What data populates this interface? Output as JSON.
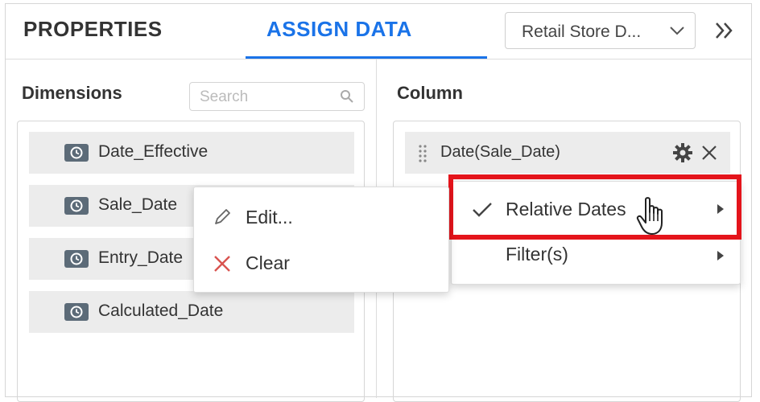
{
  "tabs": {
    "properties": "PROPERTIES",
    "assign_data": "ASSIGN DATA"
  },
  "datasource": {
    "selected": "Retail Store D..."
  },
  "dimensions": {
    "title": "Dimensions",
    "search_placeholder": "Search",
    "items": [
      {
        "label": "Date_Effective"
      },
      {
        "label": "Sale_Date"
      },
      {
        "label": "Entry_Date"
      },
      {
        "label": "Calculated_Date"
      }
    ]
  },
  "column": {
    "title": "Column",
    "item_label": "Date(Sale_Date)"
  },
  "column_menu": {
    "items": [
      {
        "label": "Relative Dates",
        "checked": true,
        "has_submenu": true
      },
      {
        "label": "Filter(s)",
        "checked": false,
        "has_submenu": true
      }
    ]
  },
  "context_menu": {
    "items": [
      {
        "label": "Edit...",
        "icon": "pencil-icon"
      },
      {
        "label": "Clear",
        "icon": "x-icon"
      }
    ]
  },
  "colors": {
    "accent": "#1a73e8",
    "highlight": "#e4141b",
    "clear_icon": "#d9534f"
  }
}
